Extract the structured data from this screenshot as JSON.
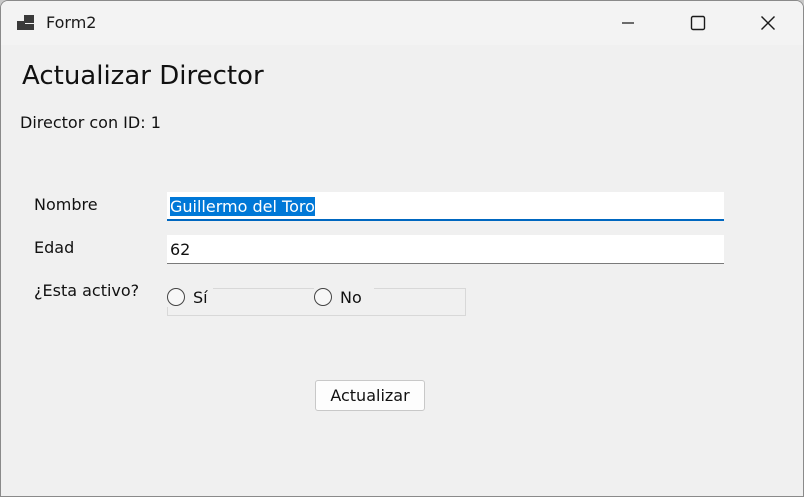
{
  "window": {
    "title": "Form2",
    "icons": {
      "app": "app-window-icon",
      "minimize": "minimize-icon",
      "maximize": "maximize-icon",
      "close": "close-icon"
    }
  },
  "form": {
    "heading": "Actualizar Director",
    "subtitle": "Director con ID: 1",
    "fields": {
      "nombre_label": "Nombre",
      "nombre_value": "Guillermo del Toro",
      "edad_label": "Edad",
      "edad_value": "62",
      "activo_label": "¿Esta activo?"
    },
    "radio": {
      "si_label": "Sí",
      "si_checked": false,
      "no_label": "No",
      "no_checked": false
    },
    "submit_label": "Actualizar"
  },
  "colors": {
    "selection": "#0078d7",
    "focus_underline": "#0067c0",
    "window_bg": "#f0f0f0"
  }
}
